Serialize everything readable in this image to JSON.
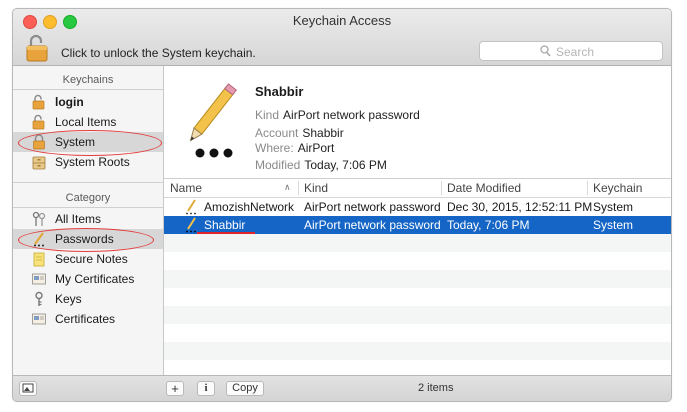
{
  "window": {
    "title": "Keychain Access"
  },
  "toolbar": {
    "lock_label": "Click to unlock the System keychain.",
    "search_placeholder": "Search"
  },
  "sidebar": {
    "keychains_header": "Keychains",
    "keychains": [
      {
        "label": "login",
        "icon": "lock-open-icon"
      },
      {
        "label": "Local Items",
        "icon": "lock-open-icon"
      },
      {
        "label": "System",
        "icon": "lock-closed-icon"
      },
      {
        "label": "System Roots",
        "icon": "cabinet-icon"
      }
    ],
    "category_header": "Category",
    "categories": [
      {
        "label": "All Items",
        "icon": "keys-icon"
      },
      {
        "label": "Passwords",
        "icon": "password-icon"
      },
      {
        "label": "Secure Notes",
        "icon": "note-icon"
      },
      {
        "label": "My Certificates",
        "icon": "certificate-icon"
      },
      {
        "label": "Keys",
        "icon": "key-icon"
      },
      {
        "label": "Certificates",
        "icon": "certificate-icon"
      }
    ]
  },
  "detail": {
    "name": "Shabbir",
    "kind_label": "Kind",
    "kind_value": "AirPort network password",
    "account_label": "Account",
    "account_value": "Shabbir",
    "where_label": "Where:",
    "where_value": "AirPort",
    "modified_label": "Modified",
    "modified_value": "Today, 7:06 PM"
  },
  "table": {
    "columns": [
      "Name",
      "Kind",
      "Date Modified",
      "Keychain"
    ],
    "rows": [
      {
        "name": "AmozishNetwork",
        "kind": "AirPort network password",
        "date": "Dec 30, 2015, 12:52:11 PM",
        "keychain": "System"
      },
      {
        "name": "Shabbir",
        "kind": "AirPort network password",
        "date": "Today, 7:06 PM",
        "keychain": "System"
      }
    ]
  },
  "bottom": {
    "copy_label": "Copy",
    "add_label": "+",
    "info_label": "i",
    "count": "2 items"
  },
  "colors": {
    "selection": "#1565c7",
    "annotation": "#e33b3b"
  }
}
